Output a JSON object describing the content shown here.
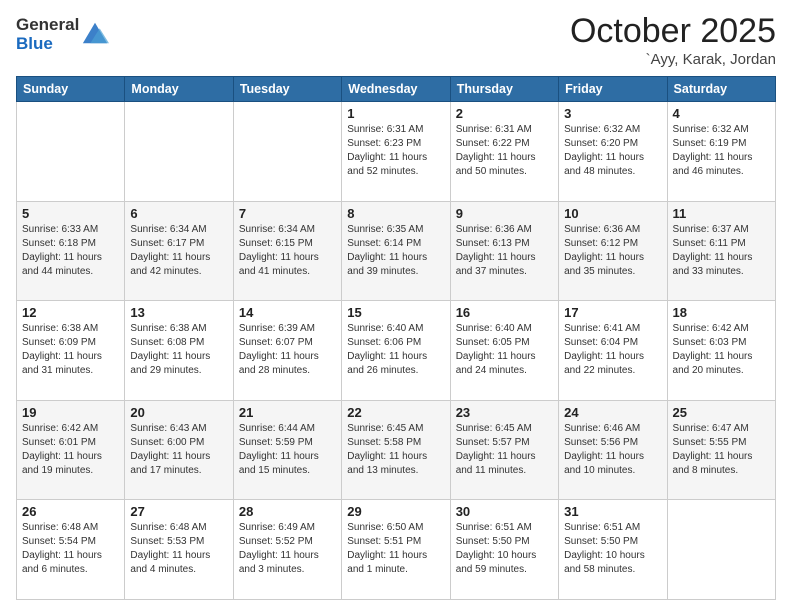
{
  "logo": {
    "general": "General",
    "blue": "Blue"
  },
  "title": "October 2025",
  "location": "`Ayy, Karak, Jordan",
  "headers": [
    "Sunday",
    "Monday",
    "Tuesday",
    "Wednesday",
    "Thursday",
    "Friday",
    "Saturday"
  ],
  "weeks": [
    [
      {
        "day": "",
        "info": ""
      },
      {
        "day": "",
        "info": ""
      },
      {
        "day": "",
        "info": ""
      },
      {
        "day": "1",
        "info": "Sunrise: 6:31 AM\nSunset: 6:23 PM\nDaylight: 11 hours\nand 52 minutes."
      },
      {
        "day": "2",
        "info": "Sunrise: 6:31 AM\nSunset: 6:22 PM\nDaylight: 11 hours\nand 50 minutes."
      },
      {
        "day": "3",
        "info": "Sunrise: 6:32 AM\nSunset: 6:20 PM\nDaylight: 11 hours\nand 48 minutes."
      },
      {
        "day": "4",
        "info": "Sunrise: 6:32 AM\nSunset: 6:19 PM\nDaylight: 11 hours\nand 46 minutes."
      }
    ],
    [
      {
        "day": "5",
        "info": "Sunrise: 6:33 AM\nSunset: 6:18 PM\nDaylight: 11 hours\nand 44 minutes."
      },
      {
        "day": "6",
        "info": "Sunrise: 6:34 AM\nSunset: 6:17 PM\nDaylight: 11 hours\nand 42 minutes."
      },
      {
        "day": "7",
        "info": "Sunrise: 6:34 AM\nSunset: 6:15 PM\nDaylight: 11 hours\nand 41 minutes."
      },
      {
        "day": "8",
        "info": "Sunrise: 6:35 AM\nSunset: 6:14 PM\nDaylight: 11 hours\nand 39 minutes."
      },
      {
        "day": "9",
        "info": "Sunrise: 6:36 AM\nSunset: 6:13 PM\nDaylight: 11 hours\nand 37 minutes."
      },
      {
        "day": "10",
        "info": "Sunrise: 6:36 AM\nSunset: 6:12 PM\nDaylight: 11 hours\nand 35 minutes."
      },
      {
        "day": "11",
        "info": "Sunrise: 6:37 AM\nSunset: 6:11 PM\nDaylight: 11 hours\nand 33 minutes."
      }
    ],
    [
      {
        "day": "12",
        "info": "Sunrise: 6:38 AM\nSunset: 6:09 PM\nDaylight: 11 hours\nand 31 minutes."
      },
      {
        "day": "13",
        "info": "Sunrise: 6:38 AM\nSunset: 6:08 PM\nDaylight: 11 hours\nand 29 minutes."
      },
      {
        "day": "14",
        "info": "Sunrise: 6:39 AM\nSunset: 6:07 PM\nDaylight: 11 hours\nand 28 minutes."
      },
      {
        "day": "15",
        "info": "Sunrise: 6:40 AM\nSunset: 6:06 PM\nDaylight: 11 hours\nand 26 minutes."
      },
      {
        "day": "16",
        "info": "Sunrise: 6:40 AM\nSunset: 6:05 PM\nDaylight: 11 hours\nand 24 minutes."
      },
      {
        "day": "17",
        "info": "Sunrise: 6:41 AM\nSunset: 6:04 PM\nDaylight: 11 hours\nand 22 minutes."
      },
      {
        "day": "18",
        "info": "Sunrise: 6:42 AM\nSunset: 6:03 PM\nDaylight: 11 hours\nand 20 minutes."
      }
    ],
    [
      {
        "day": "19",
        "info": "Sunrise: 6:42 AM\nSunset: 6:01 PM\nDaylight: 11 hours\nand 19 minutes."
      },
      {
        "day": "20",
        "info": "Sunrise: 6:43 AM\nSunset: 6:00 PM\nDaylight: 11 hours\nand 17 minutes."
      },
      {
        "day": "21",
        "info": "Sunrise: 6:44 AM\nSunset: 5:59 PM\nDaylight: 11 hours\nand 15 minutes."
      },
      {
        "day": "22",
        "info": "Sunrise: 6:45 AM\nSunset: 5:58 PM\nDaylight: 11 hours\nand 13 minutes."
      },
      {
        "day": "23",
        "info": "Sunrise: 6:45 AM\nSunset: 5:57 PM\nDaylight: 11 hours\nand 11 minutes."
      },
      {
        "day": "24",
        "info": "Sunrise: 6:46 AM\nSunset: 5:56 PM\nDaylight: 11 hours\nand 10 minutes."
      },
      {
        "day": "25",
        "info": "Sunrise: 6:47 AM\nSunset: 5:55 PM\nDaylight: 11 hours\nand 8 minutes."
      }
    ],
    [
      {
        "day": "26",
        "info": "Sunrise: 6:48 AM\nSunset: 5:54 PM\nDaylight: 11 hours\nand 6 minutes."
      },
      {
        "day": "27",
        "info": "Sunrise: 6:48 AM\nSunset: 5:53 PM\nDaylight: 11 hours\nand 4 minutes."
      },
      {
        "day": "28",
        "info": "Sunrise: 6:49 AM\nSunset: 5:52 PM\nDaylight: 11 hours\nand 3 minutes."
      },
      {
        "day": "29",
        "info": "Sunrise: 6:50 AM\nSunset: 5:51 PM\nDaylight: 11 hours\nand 1 minute."
      },
      {
        "day": "30",
        "info": "Sunrise: 6:51 AM\nSunset: 5:50 PM\nDaylight: 10 hours\nand 59 minutes."
      },
      {
        "day": "31",
        "info": "Sunrise: 6:51 AM\nSunset: 5:50 PM\nDaylight: 10 hours\nand 58 minutes."
      },
      {
        "day": "",
        "info": ""
      }
    ]
  ]
}
